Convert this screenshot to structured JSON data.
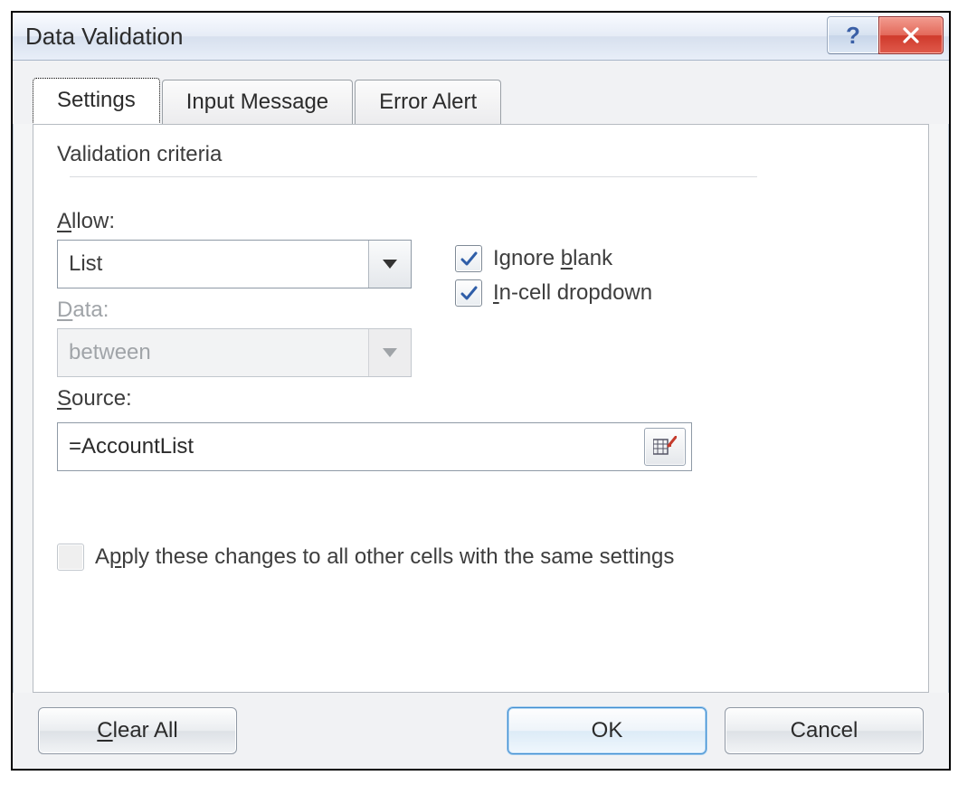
{
  "titlebar": {
    "title": "Data Validation",
    "help_label": "?"
  },
  "tabs": [
    {
      "label": "Settings",
      "active": true
    },
    {
      "label": "Input Message",
      "active": false
    },
    {
      "label": "Error Alert",
      "active": false
    }
  ],
  "group": {
    "validation_criteria_label": "Validation criteria"
  },
  "fields": {
    "allow_label": "Allow:",
    "allow_value": "List",
    "data_label": "Data:",
    "data_value": "between",
    "source_label": "Source:",
    "source_value": "=AccountList"
  },
  "checkboxes": {
    "ignore_blank_label": "Ignore blank",
    "ignore_blank_checked": true,
    "in_cell_dropdown_label": "In-cell dropdown",
    "in_cell_dropdown_checked": true,
    "apply_all_label": "Apply these changes to all other cells with the same settings",
    "apply_all_checked": false
  },
  "buttons": {
    "clear_all": "Clear All",
    "ok": "OK",
    "cancel": "Cancel"
  }
}
